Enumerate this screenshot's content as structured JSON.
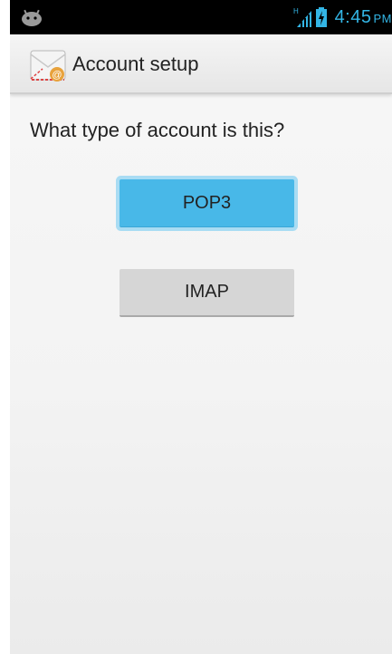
{
  "status_bar": {
    "time": "4:45",
    "ampm": "PM",
    "network_label": "H",
    "accent_color": "#33b5e5"
  },
  "action_bar": {
    "title": "Account setup",
    "icon": "email-app-icon"
  },
  "content": {
    "question": "What type of account is this?",
    "buttons": [
      {
        "label": "POP3",
        "state": "focused",
        "color": "#48b8e8"
      },
      {
        "label": "IMAP",
        "state": "normal",
        "color": "#d6d6d6"
      }
    ]
  },
  "icons": {
    "status_left": "android-notification-icon",
    "signal": "signal-icon",
    "battery": "battery-charging-icon"
  }
}
